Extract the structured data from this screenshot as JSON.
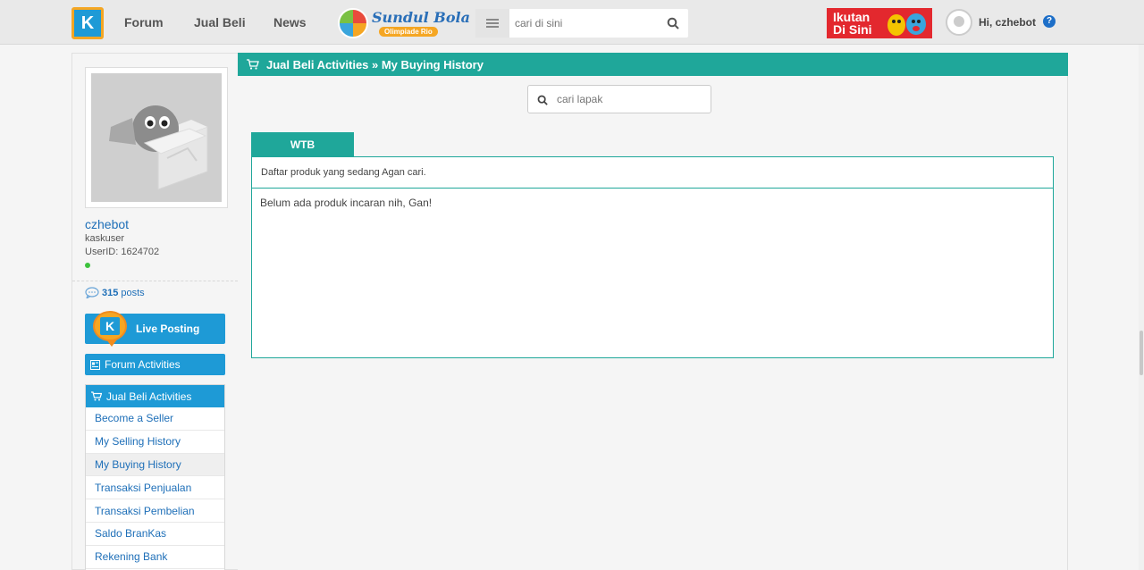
{
  "topbar": {
    "logo_text": "K",
    "nav": [
      "Forum",
      "Jual Beli",
      "News"
    ],
    "promo_title": "Sundul Bola",
    "promo_sub": "Olimpiade Rio",
    "search_placeholder": "cari di sini",
    "ad_text_1": "Ikutan",
    "ad_text_2": "Di Sini",
    "greeting": "Hi, czhebot",
    "help": "?"
  },
  "sidebar": {
    "username": "czhebot",
    "rank": "kaskuser",
    "userid": "UserID: 1624702",
    "posts_count": "315",
    "posts_label": "posts",
    "live_posting": "Live Posting",
    "forum_activities": "Forum Activities",
    "jual_beli_title": "Jual Beli Activities",
    "jual_beli_items": [
      "Become a Seller",
      "My Selling History",
      "My Buying History",
      "Transaksi Penjualan",
      "Transaksi Pembelian",
      "Saldo BranKas",
      "Rekening Bank"
    ],
    "active_item": "My Buying History"
  },
  "main": {
    "breadcrumb": "Jual Beli Activities » My Buying History",
    "lapak_placeholder": "cari lapak",
    "tab": "WTB",
    "description": "Daftar produk yang sedang Agan cari.",
    "empty_message": "Belum ada produk incaran nih, Gan!"
  },
  "colors": {
    "accent": "#1e9ad6",
    "teal": "#1fa79a",
    "orange": "#f5a623"
  }
}
